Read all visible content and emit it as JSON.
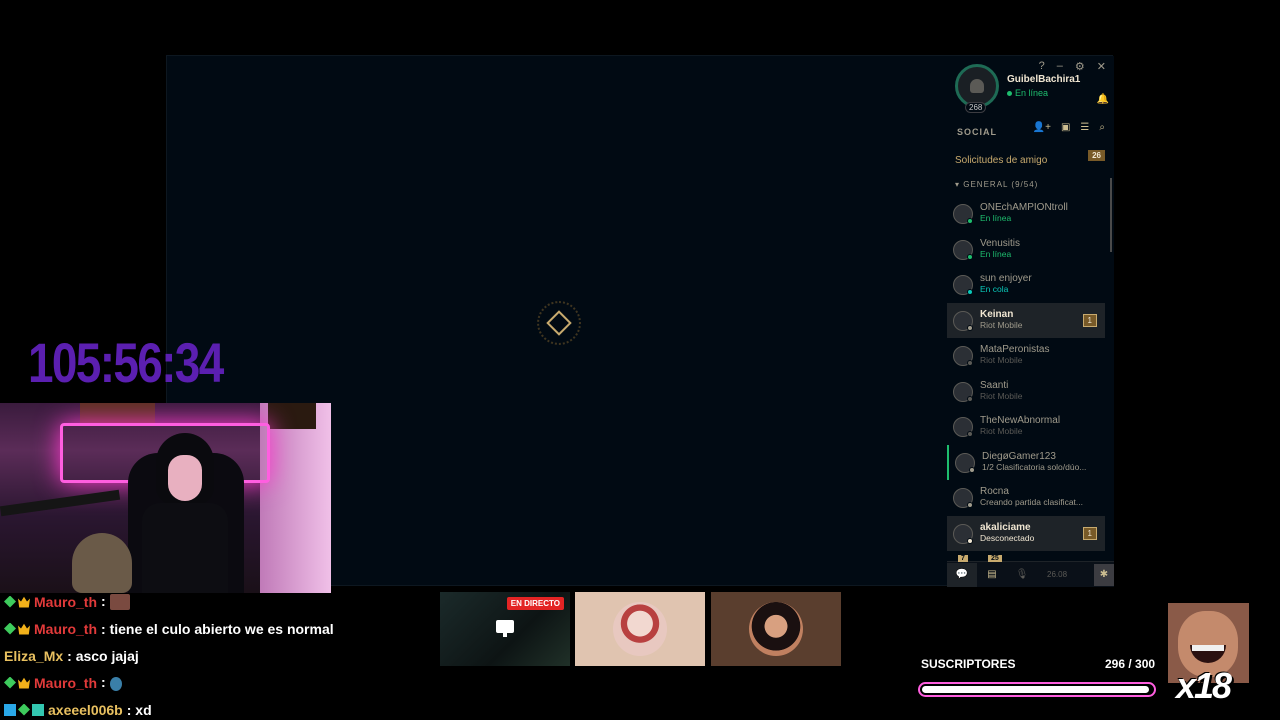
{
  "client": {
    "window_controls": [
      "?",
      "–",
      "⚙",
      "✕"
    ],
    "profile": {
      "summoner_name": "GuibelBachira1",
      "level": "268",
      "status": "En línea"
    },
    "social": {
      "title": "SOCIAL",
      "friend_requests_label": "Solicitudes de amigo",
      "friend_requests_count": "26",
      "group_label": "GENERAL (9/54)",
      "friends": [
        {
          "name": "ONEchAMPIONtroll",
          "status": "En línea",
          "status_color": "#1ebd6e",
          "highlight": false,
          "badge": ""
        },
        {
          "name": "Venusitis",
          "status": "En línea",
          "status_color": "#1ebd6e",
          "highlight": false,
          "badge": ""
        },
        {
          "name": "sun enjoyer",
          "status": "En cola",
          "status_color": "#0ac8b9",
          "highlight": false,
          "badge": ""
        },
        {
          "name": "Keinan",
          "status": "Riot Mobile",
          "status_color": "#a09b8c",
          "highlight": true,
          "badge": "1"
        },
        {
          "name": "MataPeronistas",
          "status": "Riot Mobile",
          "status_color": "#5b5a56",
          "highlight": false,
          "badge": ""
        },
        {
          "name": "Saanti",
          "status": "Riot Mobile",
          "status_color": "#5b5a56",
          "highlight": false,
          "badge": ""
        },
        {
          "name": "TheNewAbnormal",
          "status": "Riot Mobile",
          "status_color": "#5b5a56",
          "highlight": false,
          "badge": ""
        },
        {
          "name": "DiegøGamer123",
          "status": "1/2 Clasificatoria solo/dúo...",
          "status_color": "#a09b8c",
          "highlight": false,
          "badge": ""
        },
        {
          "name": "Rocna",
          "status": "Creando partida clasificat...",
          "status_color": "#a09b8c",
          "highlight": false,
          "badge": ""
        },
        {
          "name": "akaliciame",
          "status": "Desconectado",
          "status_color": "#f0e6d2",
          "highlight": true,
          "badge": "1"
        }
      ]
    },
    "bottom_bar": {
      "chat_badge": "7",
      "missions_badge": "25",
      "time": "26.08"
    }
  },
  "overlay": {
    "timer": "105:56:34",
    "chat": [
      {
        "user": "Mauro_th",
        "user_color": "#e23a3a",
        "badges": [
          "green",
          "crown"
        ],
        "message": "",
        "emote": "image"
      },
      {
        "user": "Mauro_th",
        "user_color": "#e23a3a",
        "badges": [
          "green",
          "crown"
        ],
        "message": "tiene el culo abierto we es normal",
        "emote": ""
      },
      {
        "user": "Eliza_Mx",
        "user_color": "#e8c060",
        "badges": [],
        "message": "asco jajaj",
        "emote": ""
      },
      {
        "user": "Mauro_th",
        "user_color": "#e23a3a",
        "badges": [
          "green",
          "crown"
        ],
        "message": "",
        "emote": "small"
      },
      {
        "user": "axeeel006b",
        "user_color": "#e8c060",
        "badges": [
          "blue",
          "green",
          "teal"
        ],
        "message": "xd",
        "emote": ""
      }
    ],
    "live_badge": "EN DIRECTO",
    "subs": {
      "label": "SUSCRIPTORES",
      "count": "296 / 300",
      "progress": 0.987
    },
    "emote_multiplier": "x18",
    "colors": {
      "timer": "#5b1fb0",
      "accent_gold": "#c8aa6e",
      "subs_border": "#ff5ee0"
    }
  }
}
